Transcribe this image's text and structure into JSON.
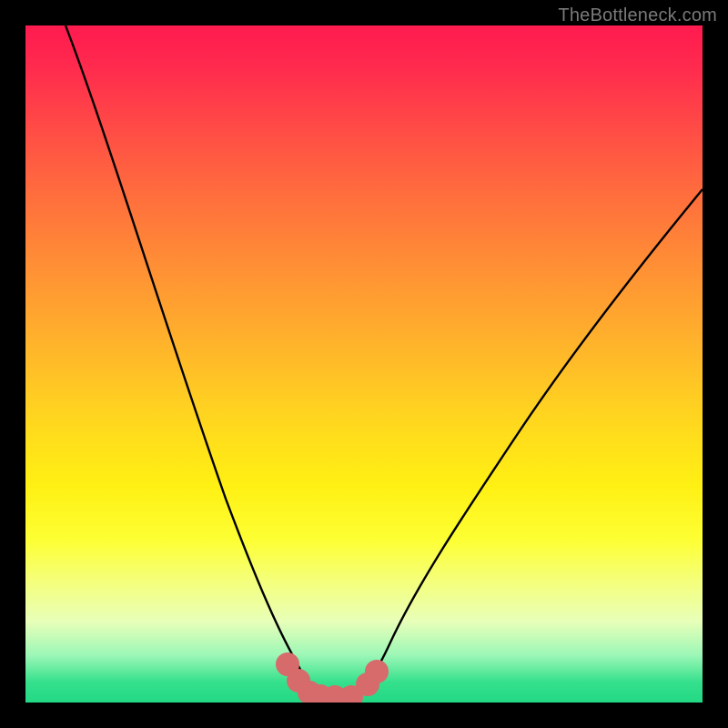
{
  "watermark": {
    "text": "TheBottleneck.com"
  },
  "colors": {
    "frame": "#000000",
    "curve": "#000000",
    "marker": "#d76a6b",
    "gradient_top": "#ff1a4f",
    "gradient_bottom": "#22d884"
  },
  "chart_data": {
    "type": "line",
    "title": "",
    "xlabel": "",
    "ylabel": "",
    "xlim": [
      0,
      100
    ],
    "ylim": [
      0,
      100
    ],
    "grid": false,
    "legend": false,
    "annotations": [],
    "series": [
      {
        "name": "bottleneck-curve",
        "x": [
          6,
          10,
          15,
          20,
          25,
          30,
          33,
          35,
          37,
          38.5,
          40,
          42,
          44,
          46,
          47.5,
          49,
          51,
          55,
          60,
          65,
          70,
          75,
          80,
          85,
          90,
          95,
          100
        ],
        "y": [
          100,
          88,
          74,
          60,
          46,
          31,
          22,
          16,
          10,
          6,
          3,
          1.5,
          1,
          1,
          1.5,
          3,
          6,
          12,
          19,
          26,
          32,
          38,
          44,
          50,
          55,
          60,
          65
        ]
      },
      {
        "name": "optimal-range-markers",
        "x": [
          38.5,
          40,
          42,
          44,
          46,
          47.5,
          49
        ],
        "y": [
          6,
          3,
          1.5,
          1,
          1,
          1.5,
          3
        ]
      }
    ]
  }
}
